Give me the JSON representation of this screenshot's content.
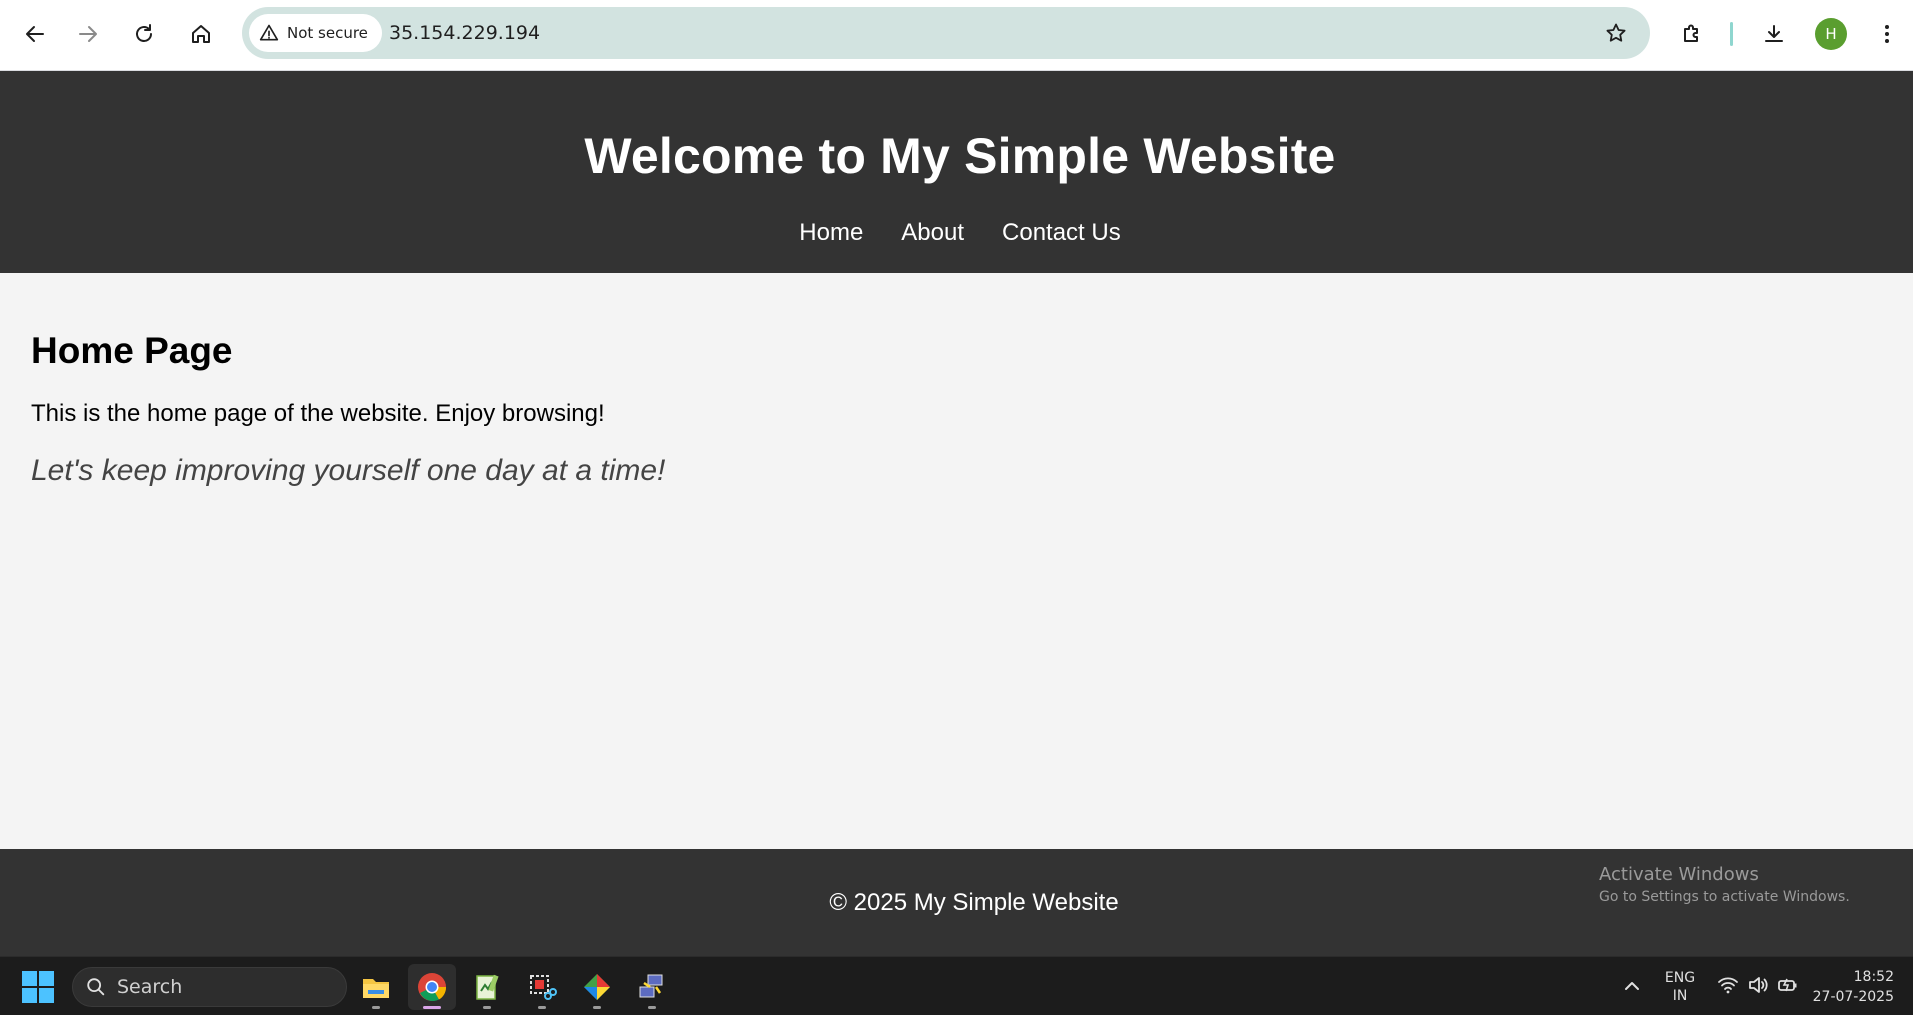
{
  "browser": {
    "security_label": "Not secure",
    "url": "35.154.229.194",
    "profile_initial": "H"
  },
  "site": {
    "title": "Welcome to My Simple Website",
    "nav": [
      "Home",
      "About",
      "Contact Us"
    ],
    "heading": "Home Page",
    "intro": "This is the home page of the website. Enjoy browsing!",
    "quote": "Let's keep improving yourself one day at a time!",
    "footer": "© 2025 My Simple Website"
  },
  "watermark": {
    "title": "Activate Windows",
    "subtitle": "Go to Settings to activate Windows."
  },
  "taskbar": {
    "search_label": "Search",
    "lang_top": "ENG",
    "lang_bottom": "IN",
    "time": "18:52",
    "date": "27-07-2025",
    "accent": "#4cc2ff"
  }
}
